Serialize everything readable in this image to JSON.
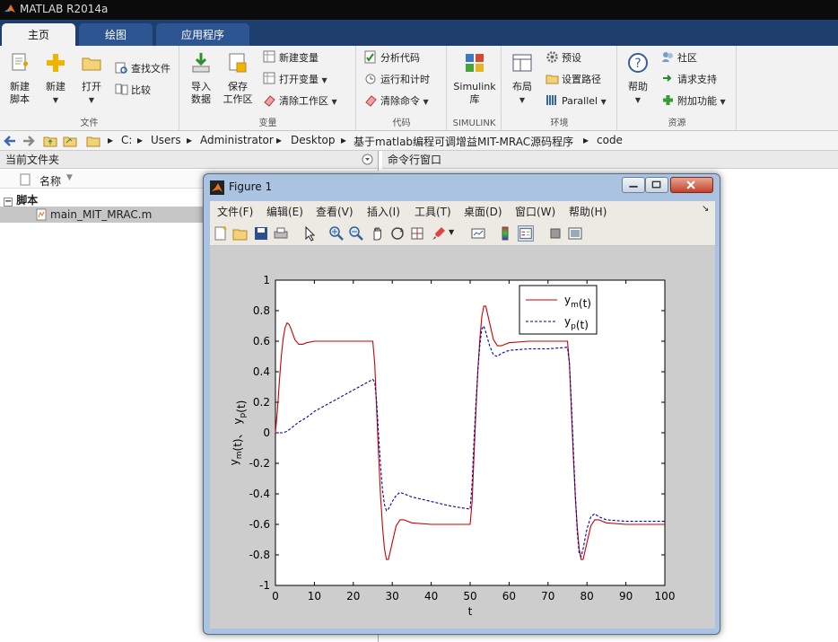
{
  "app": {
    "title": "MATLAB R2014a"
  },
  "tabs": [
    {
      "label": "主页"
    },
    {
      "label": "绘图"
    },
    {
      "label": "应用程序"
    }
  ],
  "ribbon": {
    "file": {
      "label": "文件",
      "new_script": "新建\n脚本",
      "new": "新建",
      "open": "打开",
      "find_files": "查找文件",
      "compare": "比较"
    },
    "variable": {
      "label": "变量",
      "import": "导入\n数据",
      "save_workspace": "保存\n工作区",
      "new_variable": "新建变量",
      "open_variable": "打开变量",
      "clear_workspace": "清除工作区"
    },
    "code": {
      "label": "代码",
      "analyze": "分析代码",
      "run_time": "运行和计时",
      "clear_commands": "清除命令"
    },
    "simulink": {
      "label": "SIMULINK",
      "library": "Simulink\n库"
    },
    "environment": {
      "label": "环境",
      "layout": "布局",
      "preferences": "预设",
      "set_path": "设置路径",
      "parallel": "Parallel"
    },
    "resources": {
      "label": "资源",
      "help": "帮助",
      "community": "社区",
      "support": "请求支持",
      "addons": "附加功能"
    }
  },
  "address": {
    "path": [
      "C:",
      "Users",
      "Administrator",
      "Desktop",
      "基于matlab编程可调增益MIT-MRAC源码程序",
      "code"
    ]
  },
  "current_folder": {
    "title": "当前文件夹",
    "col_name": "名称",
    "group": "脚本",
    "file": "main_MIT_MRAC.m"
  },
  "command_window": {
    "title": "命令行窗口"
  },
  "figure": {
    "title": "Figure 1",
    "menus": [
      "文件(F)",
      "编辑(E)",
      "查看(V)",
      "插入(I)",
      "工具(T)",
      "桌面(D)",
      "窗口(W)",
      "帮助(H)"
    ]
  },
  "chart_data": {
    "type": "line",
    "xlabel": "t",
    "ylabel": "y_m(t)、 y_p(t)",
    "xlim": [
      0,
      100
    ],
    "ylim": [
      -1,
      1
    ],
    "xticks": [
      0,
      10,
      20,
      30,
      40,
      50,
      60,
      70,
      80,
      90,
      100
    ],
    "yticks": [
      -1,
      -0.8,
      -0.6,
      -0.4,
      -0.2,
      0,
      0.2,
      0.4,
      0.6,
      0.8,
      1
    ],
    "grid": false,
    "legend_position": "top-right",
    "series": [
      {
        "name": "y_m(t)",
        "color": "#cc0000",
        "style": "solid",
        "x": [
          0,
          0.5,
          1,
          1.5,
          2,
          2.5,
          3,
          3.5,
          4,
          5,
          6,
          7,
          8,
          10,
          15,
          20,
          25,
          25.5,
          26,
          26.5,
          27,
          27.5,
          28,
          28.5,
          29,
          30,
          31,
          32,
          33,
          35,
          40,
          45,
          50,
          50.5,
          51,
          51.5,
          52,
          52.5,
          53,
          53.5,
          54,
          55,
          56,
          57,
          58,
          60,
          65,
          70,
          75,
          75.5,
          76,
          76.5,
          77,
          77.5,
          78,
          78.5,
          79,
          80,
          81,
          82,
          83,
          85,
          90,
          95,
          100
        ],
        "y": [
          0,
          0.15,
          0.33,
          0.5,
          0.62,
          0.69,
          0.72,
          0.71,
          0.68,
          0.61,
          0.58,
          0.58,
          0.59,
          0.6,
          0.6,
          0.6,
          0.6,
          0.45,
          0.15,
          -0.15,
          -0.42,
          -0.62,
          -0.76,
          -0.83,
          -0.83,
          -0.72,
          -0.61,
          -0.57,
          -0.57,
          -0.59,
          -0.6,
          -0.6,
          -0.6,
          -0.45,
          -0.15,
          0.15,
          0.42,
          0.62,
          0.76,
          0.83,
          0.83,
          0.72,
          0.61,
          0.57,
          0.57,
          0.59,
          0.6,
          0.6,
          0.6,
          0.45,
          0.15,
          -0.15,
          -0.42,
          -0.62,
          -0.76,
          -0.83,
          -0.83,
          -0.72,
          -0.61,
          -0.57,
          -0.57,
          -0.59,
          -0.6,
          -0.6,
          -0.6
        ]
      },
      {
        "name": "y_p(t)",
        "color": "#0000aa",
        "style": "dashed",
        "x": [
          0,
          1,
          2,
          3,
          4,
          6,
          8,
          10,
          15,
          20,
          25,
          25.5,
          26,
          26.5,
          27,
          27.5,
          28,
          28.5,
          29,
          30,
          31,
          32,
          33,
          35,
          40,
          45,
          50,
          50.5,
          51,
          51.5,
          52,
          52.5,
          53,
          53.5,
          54,
          55,
          56,
          57,
          58,
          60,
          65,
          70,
          75,
          75.5,
          76,
          76.5,
          77,
          77.5,
          78,
          78.5,
          79,
          80,
          81,
          82,
          83,
          85,
          90,
          95,
          100
        ],
        "y": [
          0,
          0,
          0,
          0.01,
          0.03,
          0.07,
          0.1,
          0.14,
          0.21,
          0.28,
          0.35,
          0.33,
          0.2,
          -0.02,
          -0.22,
          -0.38,
          -0.47,
          -0.51,
          -0.5,
          -0.45,
          -0.41,
          -0.39,
          -0.4,
          -0.42,
          -0.45,
          -0.48,
          -0.5,
          -0.33,
          -0.05,
          0.2,
          0.42,
          0.58,
          0.68,
          0.7,
          0.66,
          0.57,
          0.51,
          0.5,
          0.52,
          0.54,
          0.55,
          0.55,
          0.56,
          0.45,
          0.2,
          -0.1,
          -0.4,
          -0.65,
          -0.79,
          -0.81,
          -0.76,
          -0.63,
          -0.55,
          -0.53,
          -0.55,
          -0.57,
          -0.58,
          -0.58,
          -0.58
        ]
      }
    ]
  }
}
